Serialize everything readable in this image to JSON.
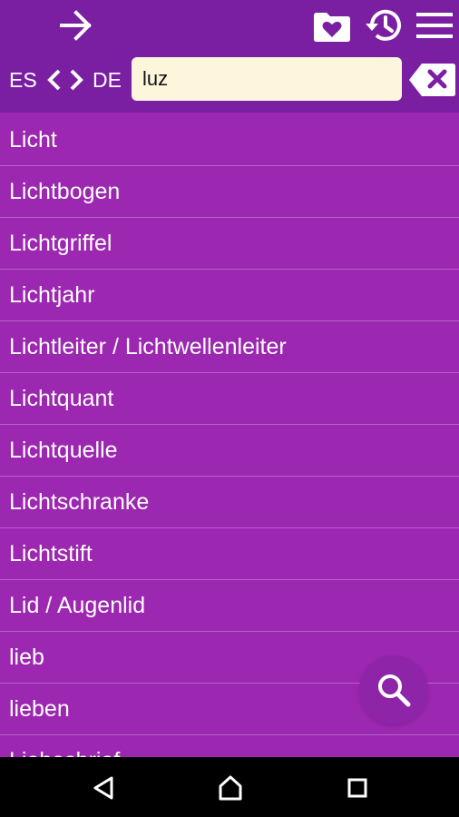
{
  "colors": {
    "toolbar": "#7b1fa2",
    "list_background": "#9c27b0",
    "divider": "#b563c7",
    "search_field": "#fdf6dc",
    "fab": "#8e24a8",
    "icon": "#ffffff"
  },
  "toolbar": {
    "icons": [
      "arrow-right-icon",
      "heart-folder-icon",
      "history-icon",
      "menu-icon"
    ]
  },
  "language_bar": {
    "source": "ES",
    "target": "DE",
    "swap_icons": [
      "chevron-left-icon",
      "chevron-right-icon"
    ]
  },
  "search": {
    "value": "luz",
    "clear_icon": "backspace-x-icon"
  },
  "results": [
    "Licht",
    "Lichtbogen",
    "Lichtgriffel",
    "Lichtjahr",
    "Lichtleiter / Lichtwellenleiter",
    "Lichtquant",
    "Lichtquelle",
    "Lichtschranke",
    "Lichtstift",
    "Lid / Augenlid",
    "lieb",
    "lieben",
    "Liebesbrief"
  ],
  "fab_icon": "search-icon",
  "navbar": {
    "icons": [
      "back-icon",
      "home-icon",
      "recents-icon"
    ]
  }
}
